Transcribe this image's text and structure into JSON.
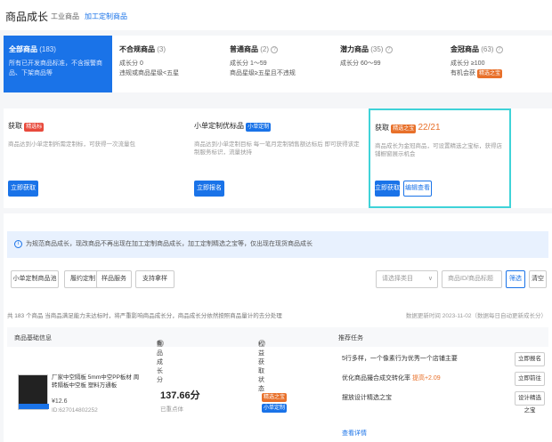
{
  "header": {
    "title": "商品成长",
    "tab_industry": "工业商品",
    "tab_custom": "加工定制商品"
  },
  "categories": [
    {
      "name": "全部商品",
      "count": "(183)",
      "desc": "所有已开发商品标准，不含报警商品、下架商品等"
    },
    {
      "name": "不合规商品",
      "count": "(3)",
      "line1": "成长分 0",
      "line2": "违规或商品星级<五星"
    },
    {
      "name": "普通商品",
      "count": "(2)",
      "line1": "成长分 1～59",
      "line2": "商品星级≥五星且不违规"
    },
    {
      "name": "潜力商品",
      "count": "(35)",
      "line1": "成长分 60～99"
    },
    {
      "name": "金冠商品",
      "count": "(63)",
      "line1": "成长分 ≥100",
      "line2": "有机会获",
      "badge": "精选之宝"
    }
  ],
  "tasks": [
    {
      "title": "获取",
      "badge": "精选标",
      "desc": "商品达到小单定制所需定制标，可获得一次流量包",
      "button": "立即获取"
    },
    {
      "title": "小单定制优标品",
      "badge": "小单定制",
      "desc": "商品达到小单定制目标 每一笔月定制销售额达标后 即可获得该定制服务标识，流量扶持",
      "button": "立即报名"
    },
    {
      "title": "获取",
      "badge": "精选之宝",
      "progress": "22/21",
      "desc": "商品成长为金冠商品，可设置精选之宝标，获得店铺橱窗展示机会",
      "button": "立即获取",
      "button2": "编辑查看"
    }
  ],
  "notice": "为规范商品成长，现改商品不再出现在加工定制商品成长，加工定制精选之宝等，仅出现在现货商品成长",
  "filters": {
    "buttons": [
      "小单定制商品池",
      "履约定制",
      "样品服务",
      "支持拿样"
    ],
    "select_placeholder": "请选择类目",
    "input_placeholder": "商品ID/商品标题",
    "search_label": "筛选",
    "clear_label": "清空"
  },
  "summary": "共 183 个商品 当商品满足能力未达标时，将严重影响商品成长分，商品成长分依然按照商品量计的去分处理",
  "updated": "数据更新时间 2023-11-02（数据每日自动更新成长分）",
  "table": {
    "headers": [
      "商品基础信息",
      "商品成长分",
      "权益获取状态",
      "推荐任务"
    ],
    "row": {
      "name": "厂家中空隔板 5mm中空PP板材 周转隔板中空板 塑料万通板",
      "price": "¥12.6",
      "id": "ID:627014802252",
      "score": "137.66分",
      "score_sub": "已重点体",
      "rights": [
        "精选之宝",
        "小单定制"
      ],
      "recs": [
        {
          "text": "5行多样，一个像素行为优秀一个店铺主要",
          "btn": "立即报名"
        },
        {
          "text": "优化商品撮合成交转化率",
          "extra": "提高+2.09",
          "btn": "立即前往"
        },
        {
          "text": "摆放设计精选之宝",
          "btn": "设计精选之宝"
        },
        {
          "text": "查看详情"
        }
      ]
    }
  },
  "colors": {
    "primary": "#1a73e8",
    "accent": "#e8702a",
    "highlight": "#3fd3d8"
  }
}
